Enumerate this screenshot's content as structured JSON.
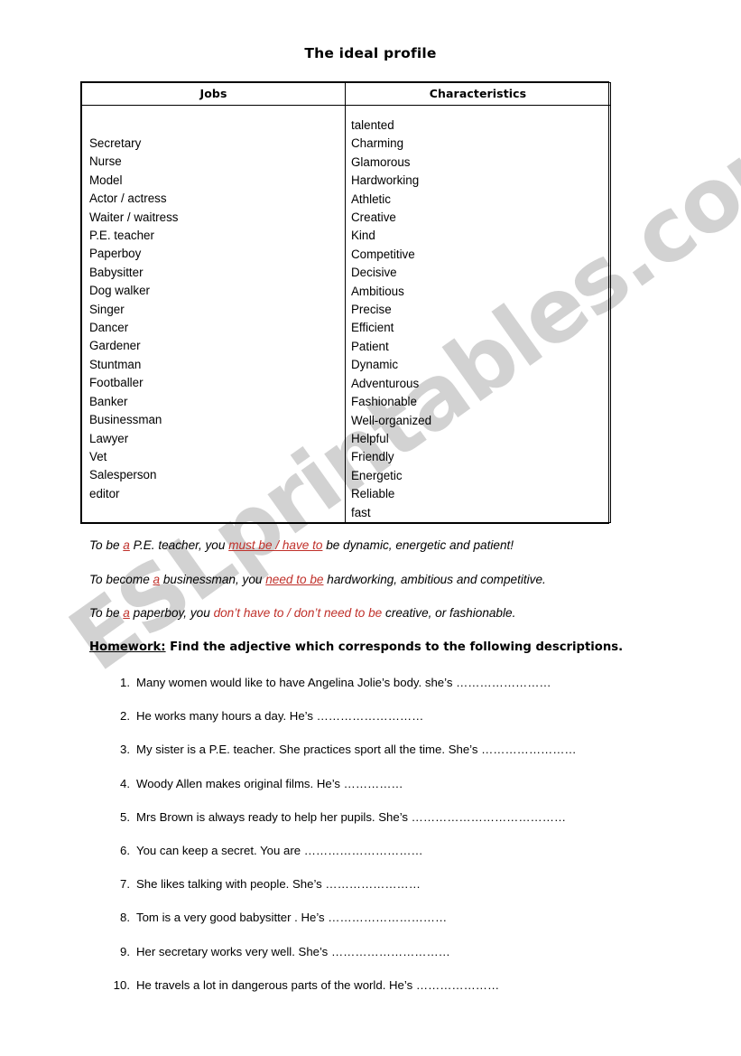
{
  "document": {
    "title": "The ideal profile",
    "watermark": "ESLprintables.com",
    "watermark_color": "#d2d2d2",
    "accent_red": "#c0302a"
  },
  "table": {
    "headers": {
      "jobs": "Jobs",
      "characteristics": "Characteristics"
    },
    "jobs": [
      "Secretary",
      "Nurse",
      "Model",
      "Actor / actress",
      "Waiter / waitress",
      "P.E. teacher",
      "Paperboy",
      "Babysitter",
      "Dog walker",
      "Singer",
      "Dancer",
      "Gardener",
      "Stuntman",
      "Footballer",
      "Banker",
      "Businessman",
      "Lawyer",
      "Vet",
      "Salesperson",
      "editor"
    ],
    "characteristics": [
      "talented",
      "Charming",
      "Glamorous",
      "Hardworking",
      "Athletic",
      "Creative",
      "Kind",
      "Competitive",
      "Decisive",
      "Ambitious",
      "Precise",
      "Efficient",
      "Patient",
      "Dynamic",
      "Adventurous",
      "Fashionable",
      "Well-organized",
      "Helpful",
      "Friendly",
      "Energetic",
      "Reliable",
      "fast"
    ]
  },
  "examples": [
    {
      "part1": "To be ",
      "red1": "a",
      "part2": " P.E. teacher, you ",
      "red2": "must be / have to",
      "part3": " be dynamic, energetic and patient!"
    },
    {
      "part1": "To become ",
      "red1": "a",
      "part2": " businessman, you ",
      "red2": "need to be",
      "part3": " hardworking, ambitious and competitive."
    },
    {
      "part1": "To be ",
      "red1": "a",
      "part2": " paperboy, you ",
      "red2": "don’t have to / don’t need to be",
      "part3": " creative, or fashionable."
    }
  ],
  "homework": {
    "label": "Homework:",
    "instruction": " Find the adjective which corresponds to the following descriptions.",
    "questions": [
      {
        "num": "1.",
        "text": "Many women would like to have Angelina  Jolie’s body.  she’s ……………………"
      },
      {
        "num": "2.",
        "text": " He works many hours a day. He’s ………………………"
      },
      {
        "num": "3.",
        "text": "My sister is a P.E. teacher. She  practices sport all the time.  She’s ……………………"
      },
      {
        "num": "4.",
        "text": "Woody Allen makes original films. He’s ……………"
      },
      {
        "num": "5.",
        "text": "Mrs Brown is always ready to help her pupils. She’s …………………………………"
      },
      {
        "num": "6.",
        "text": "You can keep a secret. You are …………………………"
      },
      {
        "num": "7.",
        "text": "She likes talking with people. She’s ……………………"
      },
      {
        "num": "8.",
        "text": "Tom is a very good babysitter . He’s  …………………………"
      },
      {
        "num": "9.",
        "text": "Her secretary works very well. She’s …………………………"
      },
      {
        "num": "10.",
        "text": "He travels a lot in dangerous parts of the world. He’s …………………"
      }
    ]
  }
}
